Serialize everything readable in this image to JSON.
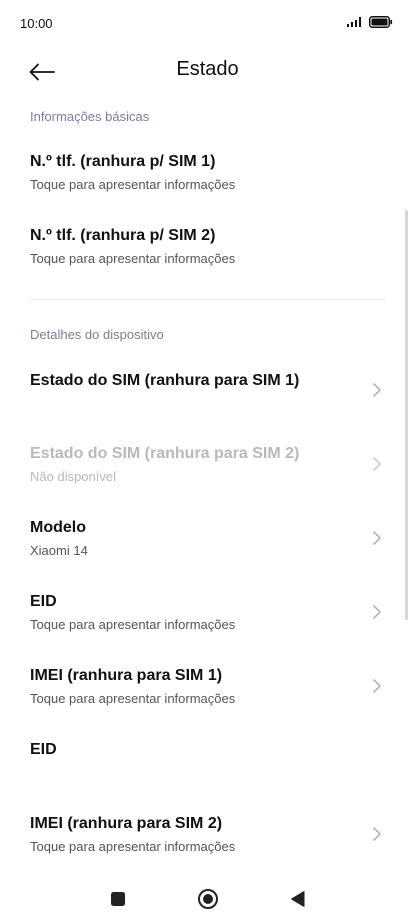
{
  "status_bar": {
    "time": "10:00",
    "icons": [
      "signal-icon",
      "battery-icon"
    ]
  },
  "header": {
    "title": "Estado",
    "back_icon": "arrow-left-icon"
  },
  "sections": {
    "basic": {
      "label": "Informações básicas",
      "items": [
        {
          "title": "N.º tlf. (ranhura p/ SIM 1)",
          "subtitle": "Toque para apresentar informações"
        },
        {
          "title": "N.º tlf. (ranhura p/ SIM 2)",
          "subtitle": "Toque para apresentar informações"
        }
      ]
    },
    "device": {
      "label": "Detalhes do dispositivo",
      "items": [
        {
          "title": "Estado do SIM (ranhura para SIM 1)",
          "subtitle": "",
          "enabled": true
        },
        {
          "title": "Estado do SIM (ranhura para SIM 2)",
          "subtitle": "Não disponível",
          "enabled": false
        },
        {
          "title": "Modelo",
          "subtitle": "Xiaomi 14",
          "enabled": true
        },
        {
          "title": "EID",
          "subtitle": "Toque para apresentar informações",
          "enabled": true
        },
        {
          "title": "IMEI (ranhura para SIM 1)",
          "subtitle": "Toque para apresentar informações",
          "enabled": true
        },
        {
          "title": "EID",
          "subtitle": "",
          "enabled": true
        },
        {
          "title": "IMEI (ranhura para SIM 2)",
          "subtitle": "Toque para apresentar informações",
          "enabled": true
        }
      ]
    }
  },
  "nav_bar": {
    "buttons": [
      "recents-square-icon",
      "home-circle-icon",
      "back-triangle-icon"
    ]
  },
  "colors": {
    "section_label": "#7d7f99",
    "disabled_text": "#b9b9b9",
    "chevron": "#b5b5b5"
  }
}
